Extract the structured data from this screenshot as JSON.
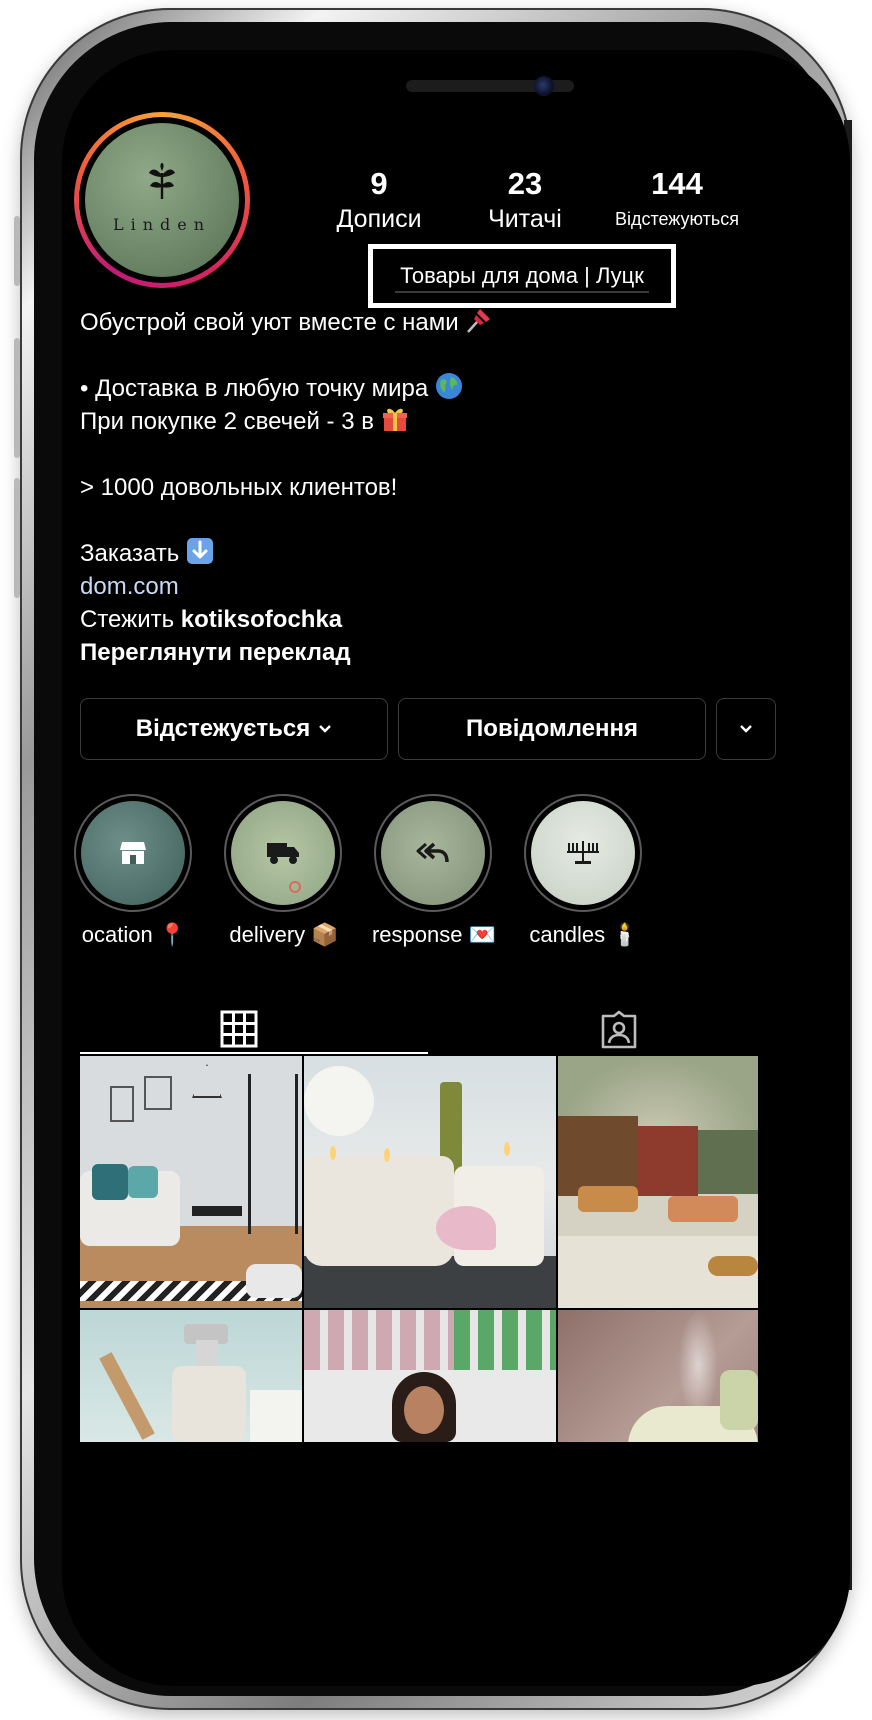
{
  "profile": {
    "brand": "Linden",
    "stats": [
      {
        "value": "9",
        "label": "Дописи"
      },
      {
        "value": "23",
        "label": "Читачі"
      },
      {
        "value": "144",
        "label": "Відстежуються"
      }
    ],
    "category": "Товары для дома | Луцк",
    "bio": {
      "line1": "Обустрой свой уют вместе с нами",
      "line2": "• Доставка в любую точку мира",
      "line3": "При покупке 2 свечей - 3 в",
      "line4": "> 1000 довольных клиентов!",
      "line5": "Заказать",
      "link": "dom.com",
      "follow_prefix": "Стежить",
      "follow_user": "kotiksofochka",
      "translate": "Переглянути переклад"
    }
  },
  "buttons": {
    "following": "Відстежується",
    "message": "Повідомлення"
  },
  "highlights": [
    {
      "label": "ocation 📍",
      "icon": "store-icon"
    },
    {
      "label": "delivery 📦",
      "icon": "truck-icon"
    },
    {
      "label": "response 💌",
      "icon": "reply-all-icon"
    },
    {
      "label": "candles 🕯️",
      "icon": "menorah-icon"
    }
  ],
  "tabs": [
    {
      "name": "posts-grid",
      "icon": "grid-icon",
      "active": true
    },
    {
      "name": "tagged",
      "icon": "tagged-person-icon",
      "active": false
    }
  ],
  "posts": [
    {
      "subject": "living room"
    },
    {
      "subject": "candles"
    },
    {
      "subject": "store interior"
    },
    {
      "subject": "soap dispenser"
    },
    {
      "subject": "shop woman"
    },
    {
      "subject": "aroma diffuser"
    }
  ],
  "colors": {
    "background": "#000000",
    "text": "#ffffff",
    "link": "#c7d9f5",
    "story_ring_start": "#f7a33a",
    "story_ring_end": "#c01b78"
  }
}
